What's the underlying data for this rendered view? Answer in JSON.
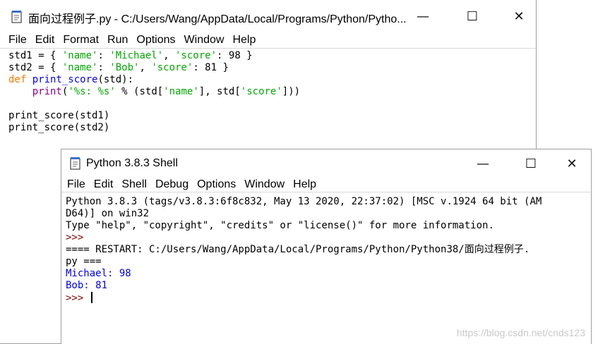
{
  "editor": {
    "title": "面向过程例子.py - C:/Users/Wang/AppData/Local/Programs/Python/Pytho...",
    "menu": [
      "File",
      "Edit",
      "Format",
      "Run",
      "Options",
      "Window",
      "Help"
    ],
    "code": [
      [
        {
          "t": "std1 = { ",
          "c": ""
        },
        {
          "t": "'name'",
          "c": "st"
        },
        {
          "t": ": ",
          "c": ""
        },
        {
          "t": "'Michael'",
          "c": "st"
        },
        {
          "t": ", ",
          "c": ""
        },
        {
          "t": "'score'",
          "c": "st"
        },
        {
          "t": ": 98 }",
          "c": ""
        }
      ],
      [
        {
          "t": "std2 = { ",
          "c": ""
        },
        {
          "t": "'name'",
          "c": "st"
        },
        {
          "t": ": ",
          "c": ""
        },
        {
          "t": "'Bob'",
          "c": "st"
        },
        {
          "t": ", ",
          "c": ""
        },
        {
          "t": "'score'",
          "c": "st"
        },
        {
          "t": ": 81 }",
          "c": ""
        }
      ],
      [
        {
          "t": "def",
          "c": "kw"
        },
        {
          "t": " ",
          "c": ""
        },
        {
          "t": "print_score",
          "c": "fn"
        },
        {
          "t": "(std):",
          "c": ""
        }
      ],
      [
        {
          "t": "    ",
          "c": ""
        },
        {
          "t": "print",
          "c": "bi"
        },
        {
          "t": "(",
          "c": ""
        },
        {
          "t": "'%s: %s'",
          "c": "st"
        },
        {
          "t": " % (std[",
          "c": ""
        },
        {
          "t": "'name'",
          "c": "st"
        },
        {
          "t": "], std[",
          "c": ""
        },
        {
          "t": "'score'",
          "c": "st"
        },
        {
          "t": "]))",
          "c": ""
        }
      ],
      [],
      [
        {
          "t": "print_score(std1)",
          "c": ""
        }
      ],
      [
        {
          "t": "print_score(std2)",
          "c": ""
        }
      ]
    ]
  },
  "shell": {
    "title": "Python 3.8.3 Shell",
    "menu": [
      "File",
      "Edit",
      "Shell",
      "Debug",
      "Options",
      "Window",
      "Help"
    ],
    "lines": [
      [
        {
          "t": "Python 3.8.3 (tags/v3.8.3:6f8c832, May 13 2020, 22:37:02) [MSC v.1924 64 bit (AM",
          "c": ""
        }
      ],
      [
        {
          "t": "D64)] on win32",
          "c": ""
        }
      ],
      [
        {
          "t": "Type \"help\", \"copyright\", \"credits\" or \"license()\" for more information.",
          "c": ""
        }
      ],
      [
        {
          "t": ">>> ",
          "c": "prompt"
        }
      ],
      [
        {
          "t": "==== RESTART: C:/Users/Wang/AppData/Local/Programs/Python/Python38/面向过程例子.",
          "c": ""
        }
      ],
      [
        {
          "t": "py ===",
          "c": ""
        }
      ],
      [
        {
          "t": "Michael: 98",
          "c": "out"
        }
      ],
      [
        {
          "t": "Bob: 81",
          "c": "out"
        }
      ],
      [
        {
          "t": ">>> ",
          "c": "prompt"
        },
        {
          "t": "",
          "c": "caret"
        }
      ]
    ]
  },
  "window_controls": {
    "minimize": "—",
    "maximize": "☐",
    "close": "✕"
  },
  "watermark": "https://blog.csdn.net/cnds123"
}
